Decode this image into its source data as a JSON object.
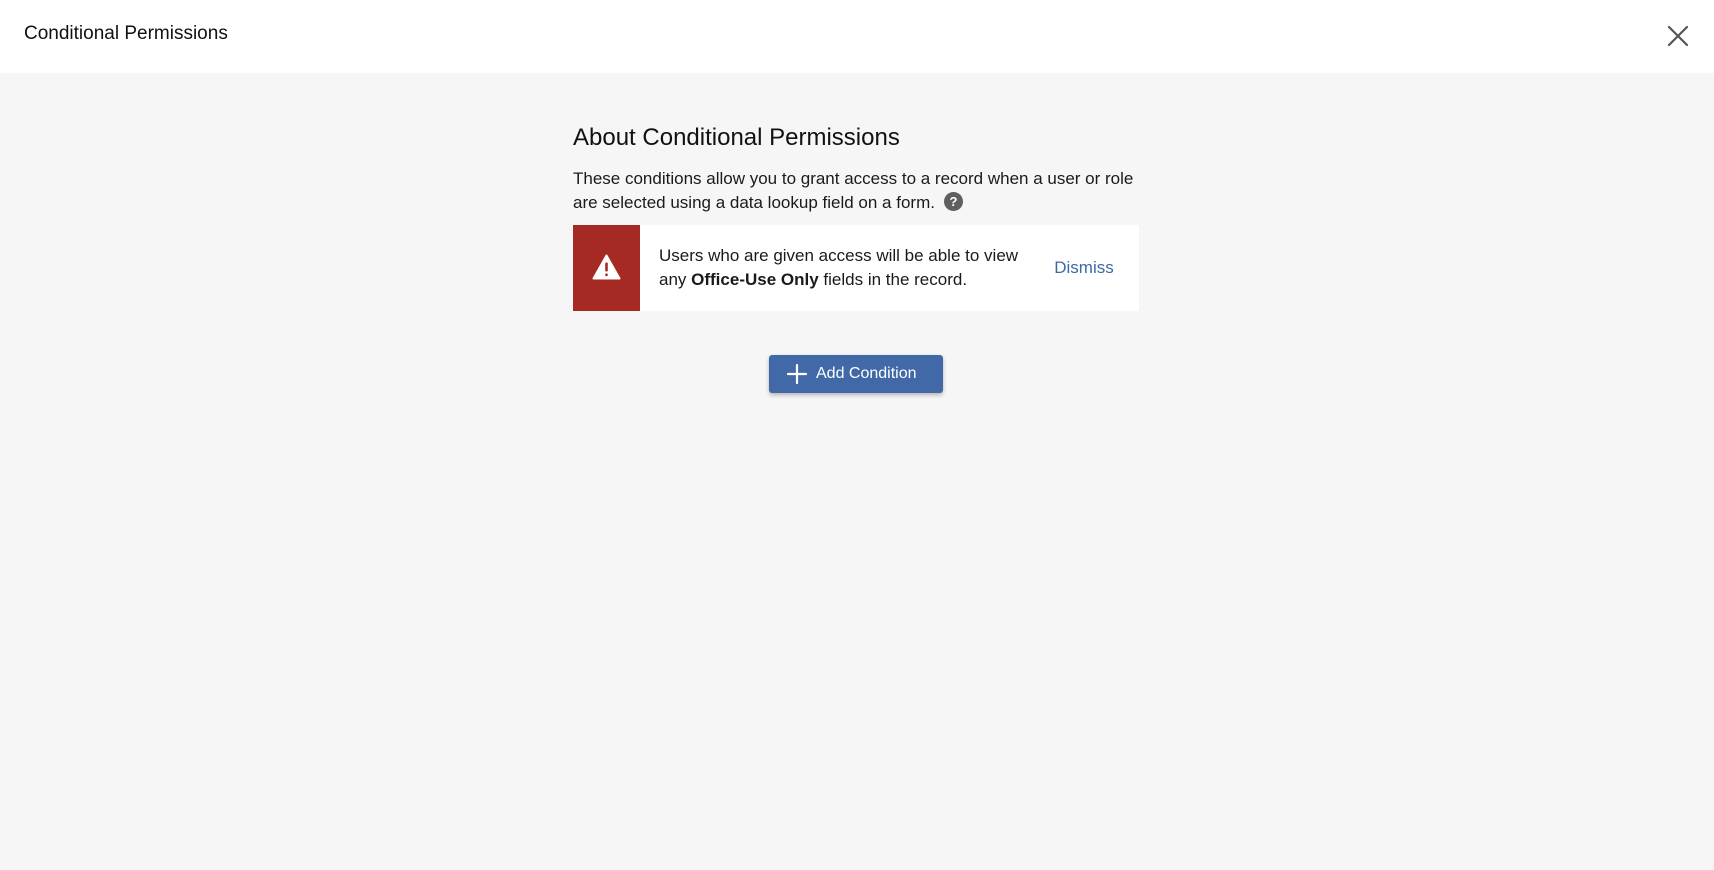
{
  "header": {
    "title": "Conditional Permissions",
    "close_icon": "close-icon"
  },
  "about": {
    "title": "About Conditional Permissions",
    "description": "These conditions allow you to grant access to a record when a user or role are selected using a data lookup field on a form.",
    "help_icon": "question-circle-icon"
  },
  "warning": {
    "icon": "warning-triangle-icon",
    "text_before": "Users who are given access will be able to view any ",
    "text_bold": "Office-Use Only",
    "text_after": " fields in the record.",
    "dismiss_label": "Dismiss",
    "accent_color": "#a52a24"
  },
  "actions": {
    "add_condition_label": "Add Condition",
    "add_icon": "plus-icon",
    "button_color": "#4169a8"
  },
  "colors": {
    "background": "#f6f6f6",
    "header_background": "#ffffff",
    "link": "#3c6aa6"
  }
}
